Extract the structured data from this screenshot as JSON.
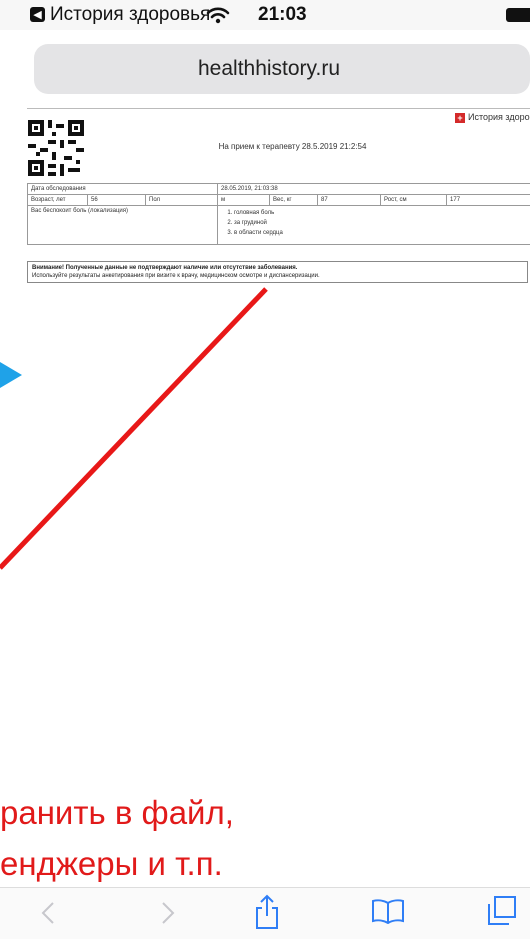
{
  "status_bar": {
    "back_app": "История здоровья",
    "time": "21:03"
  },
  "address_bar": {
    "url": "healthhistory.ru"
  },
  "document": {
    "brand": "История здоров",
    "title": "На прием к терапевту 28.5.2019 21:2:54",
    "rows": {
      "exam_date_label": "Дата обследования",
      "exam_date_value": "28.05.2019, 21:03:38",
      "age_label": "Возраст, лет",
      "age_value": "56",
      "sex_label": "Пол",
      "sex_value": "м",
      "weight_label": "Вес, кг",
      "weight_value": "87",
      "height_label": "Рост, см",
      "height_value": "177",
      "pain_label": "Вас беспокоит боль (локализация)",
      "pain_items": [
        "головная боль",
        "за грудиной",
        "в области сердца"
      ]
    },
    "notice_bold": "Внимание! Полученные данные не подтверждают наличие или отсутствие заболевания.",
    "notice_text": "Используйте результаты анкетирования при визите к врачу, медицинском осмотре и диспансеризации."
  },
  "annotation": {
    "line1": "ранить в файл,",
    "line2": "енджеры и т.п.",
    "color": "#e11a1a",
    "arrow_color": "#1fa2e8"
  },
  "toolbar": {
    "icons": [
      "back-icon",
      "forward-icon",
      "share-icon",
      "bookmarks-icon",
      "tabs-icon"
    ]
  }
}
